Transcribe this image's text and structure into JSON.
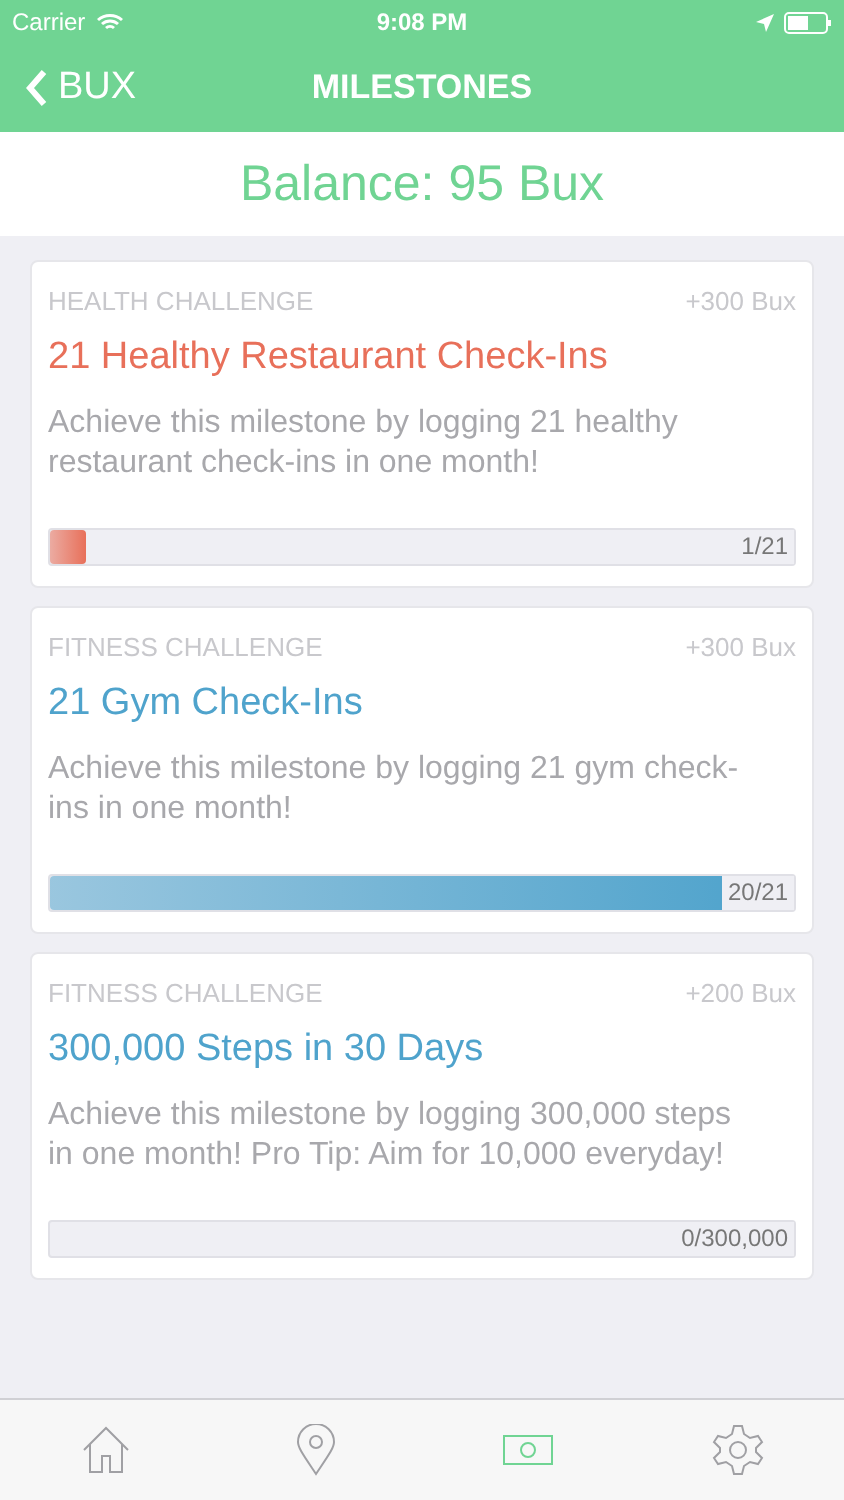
{
  "status_bar": {
    "carrier": "Carrier",
    "time": "9:08 PM"
  },
  "nav": {
    "back": "BUX",
    "title": "MILESTONES"
  },
  "balance": "Balance: 95 Bux",
  "milestones": [
    {
      "category": "HEALTH CHALLENGE",
      "reward": "+300 Bux",
      "title": "21 Healthy Restaurant Check-Ins",
      "color": "#e8705a",
      "description": "Achieve this milestone by logging 21 healthy restaurant check-ins in one month!",
      "level": 0.048,
      "progress": "1/21"
    },
    {
      "category": "FITNESS CHALLENGE",
      "reward": "+300 Bux",
      "title": "21 Gym Check-Ins",
      "color": "#4fa3cc",
      "description": "Achieve this milestone by logging 21 gym check-ins in one month!",
      "level": 0.952,
      "progress": "20/21"
    },
    {
      "category": "FITNESS CHALLENGE",
      "reward": "+200 Bux",
      "title": "300,000 Steps in 30 Days",
      "color": "#4fa3cc",
      "description": "Achieve this milestone by logging 300,000 steps in one month! Pro Tip: Aim for 10,000 everyday!",
      "progress": "0/300,000"
    }
  ],
  "tabs": [
    {
      "kind": "home",
      "selected": false
    },
    {
      "kind": "location",
      "selected": false
    },
    {
      "kind": "money",
      "selected": true
    },
    {
      "kind": "settings",
      "selected": false
    }
  ]
}
